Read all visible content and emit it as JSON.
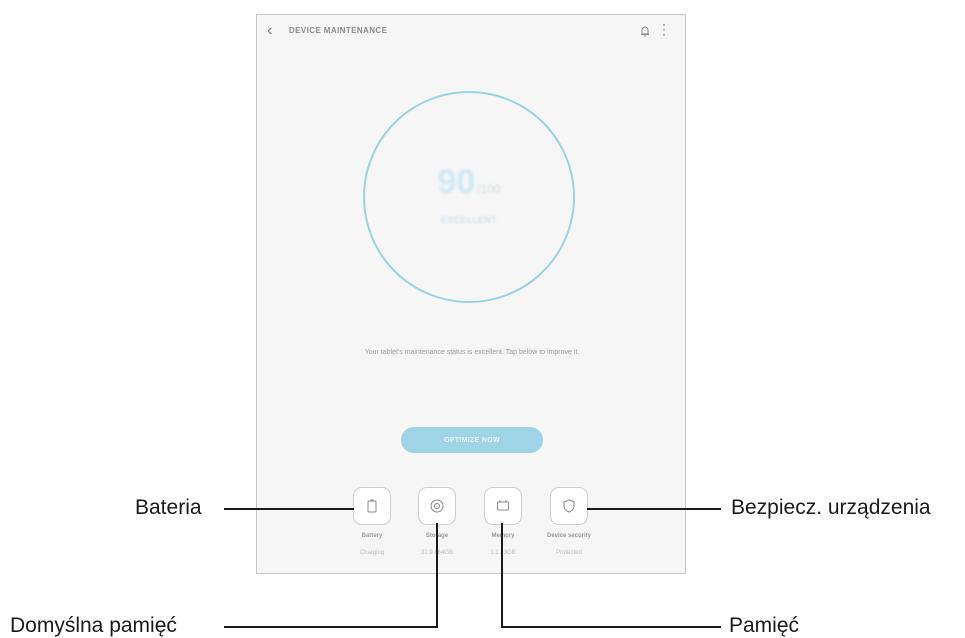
{
  "app_bar": {
    "title": "DEVICE MAINTENANCE",
    "back_icon": "chevron-left-icon",
    "notification_icon": "bell-icon",
    "menu_icon": "more-vertical-icon"
  },
  "score": {
    "value": "90",
    "unit": "/100",
    "status": "EXCELLENT"
  },
  "message": "Your tablet's maintenance status is excellent. Tap below to improve it.",
  "optimize_button": "OPTIMIZE NOW",
  "tiles": [
    {
      "label": "Battery",
      "value": "Charging",
      "icon": "battery-icon"
    },
    {
      "label": "Storage",
      "value": "32.9 / 64GB",
      "icon": "storage-icon"
    },
    {
      "label": "Memory",
      "value": "1.1 / 3GB",
      "icon": "memory-icon"
    },
    {
      "label": "Device security",
      "value": "Protected",
      "icon": "shield-icon"
    }
  ],
  "callouts": {
    "battery": "Bateria",
    "storage": "Domyślna pamięć",
    "memory": "Pamięć",
    "security": "Bezpiecz. urządzenia"
  },
  "colors": {
    "accent": "#9bd3e3",
    "button": "#9fd3e6",
    "background": "#f6f6f6"
  }
}
